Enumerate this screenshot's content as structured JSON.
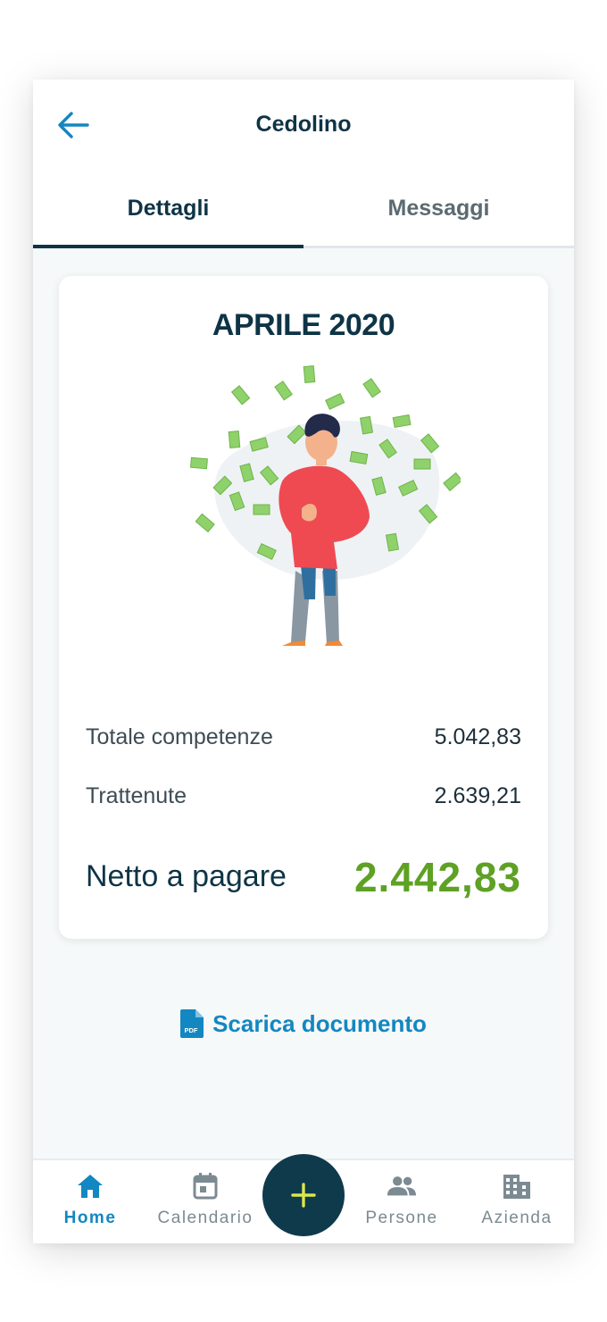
{
  "header": {
    "title": "Cedolino",
    "back_icon": "arrow-left-icon"
  },
  "tabs": [
    {
      "label": "Dettagli",
      "active": true
    },
    {
      "label": "Messaggi",
      "active": false
    }
  ],
  "payslip": {
    "month": "APRILE 2020",
    "rows": [
      {
        "label": "Totale competenze",
        "value": "5.042,83"
      },
      {
        "label": "Trattenute",
        "value": "2.639,21"
      }
    ],
    "net": {
      "label": "Netto a pagare",
      "value": "2.442,83"
    }
  },
  "download": {
    "label": "Scarica documento",
    "icon": "pdf-file-icon",
    "icon_text": "PDF"
  },
  "bottom_nav": {
    "items": [
      {
        "label": "Home",
        "icon": "home-icon",
        "active": true
      },
      {
        "label": "Calendario",
        "icon": "calendar-icon",
        "active": false
      },
      {
        "label": "Persone",
        "icon": "people-icon",
        "active": false
      },
      {
        "label": "Azienda",
        "icon": "building-icon",
        "active": false
      }
    ],
    "fab_icon": "plus-icon"
  },
  "colors": {
    "primary_dark": "#0e3446",
    "accent_blue": "#1387c1",
    "net_green": "#5ea124",
    "fab_plus": "#d8e84a"
  }
}
